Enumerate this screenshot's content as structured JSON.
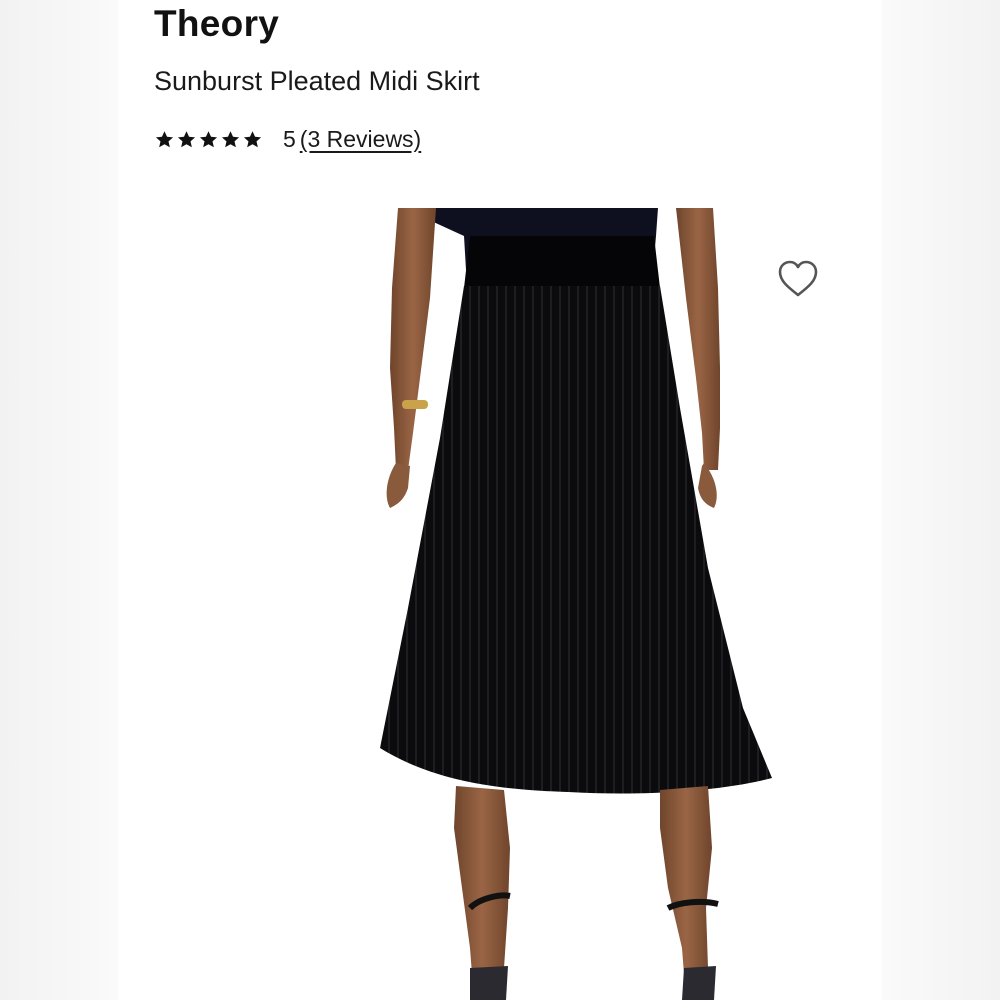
{
  "product": {
    "brand": "Theory",
    "name": "Sunburst Pleated Midi Skirt",
    "rating_value": "5",
    "rating_stars": 5,
    "reviews_label": "(3 Reviews)"
  },
  "image": {
    "icon": "product-photo",
    "alt": "Sunburst Pleated Midi Skirt"
  },
  "wishlist": {
    "icon": "heart-outline-icon"
  },
  "colors": {
    "text": "#111111",
    "skirt": "#0b0b0d",
    "skin": "#8a5a3c",
    "heart_stroke": "#555555"
  }
}
